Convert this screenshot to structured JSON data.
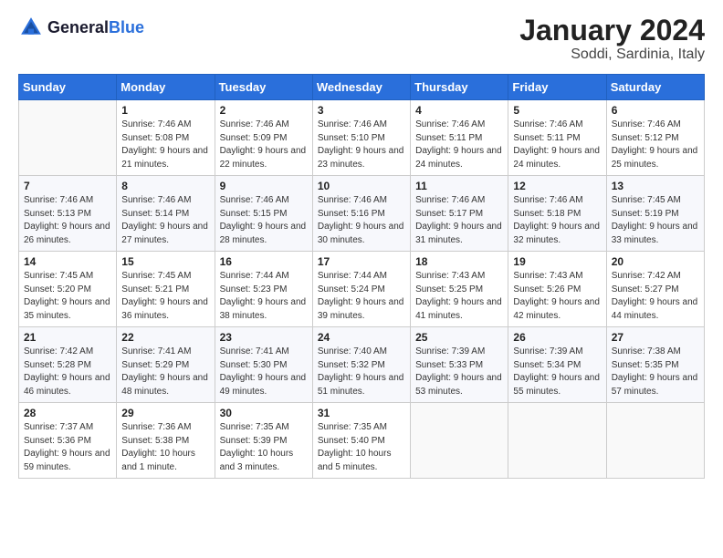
{
  "logo": {
    "general": "General",
    "blue": "Blue"
  },
  "title": "January 2024",
  "subtitle": "Soddi, Sardinia, Italy",
  "weekdays": [
    "Sunday",
    "Monday",
    "Tuesday",
    "Wednesday",
    "Thursday",
    "Friday",
    "Saturday"
  ],
  "weeks": [
    [
      {
        "day": "",
        "sunrise": "",
        "sunset": "",
        "daylight": ""
      },
      {
        "day": "1",
        "sunrise": "Sunrise: 7:46 AM",
        "sunset": "Sunset: 5:08 PM",
        "daylight": "Daylight: 9 hours and 21 minutes."
      },
      {
        "day": "2",
        "sunrise": "Sunrise: 7:46 AM",
        "sunset": "Sunset: 5:09 PM",
        "daylight": "Daylight: 9 hours and 22 minutes."
      },
      {
        "day": "3",
        "sunrise": "Sunrise: 7:46 AM",
        "sunset": "Sunset: 5:10 PM",
        "daylight": "Daylight: 9 hours and 23 minutes."
      },
      {
        "day": "4",
        "sunrise": "Sunrise: 7:46 AM",
        "sunset": "Sunset: 5:11 PM",
        "daylight": "Daylight: 9 hours and 24 minutes."
      },
      {
        "day": "5",
        "sunrise": "Sunrise: 7:46 AM",
        "sunset": "Sunset: 5:11 PM",
        "daylight": "Daylight: 9 hours and 24 minutes."
      },
      {
        "day": "6",
        "sunrise": "Sunrise: 7:46 AM",
        "sunset": "Sunset: 5:12 PM",
        "daylight": "Daylight: 9 hours and 25 minutes."
      }
    ],
    [
      {
        "day": "7",
        "sunrise": "Sunrise: 7:46 AM",
        "sunset": "Sunset: 5:13 PM",
        "daylight": "Daylight: 9 hours and 26 minutes."
      },
      {
        "day": "8",
        "sunrise": "Sunrise: 7:46 AM",
        "sunset": "Sunset: 5:14 PM",
        "daylight": "Daylight: 9 hours and 27 minutes."
      },
      {
        "day": "9",
        "sunrise": "Sunrise: 7:46 AM",
        "sunset": "Sunset: 5:15 PM",
        "daylight": "Daylight: 9 hours and 28 minutes."
      },
      {
        "day": "10",
        "sunrise": "Sunrise: 7:46 AM",
        "sunset": "Sunset: 5:16 PM",
        "daylight": "Daylight: 9 hours and 30 minutes."
      },
      {
        "day": "11",
        "sunrise": "Sunrise: 7:46 AM",
        "sunset": "Sunset: 5:17 PM",
        "daylight": "Daylight: 9 hours and 31 minutes."
      },
      {
        "day": "12",
        "sunrise": "Sunrise: 7:46 AM",
        "sunset": "Sunset: 5:18 PM",
        "daylight": "Daylight: 9 hours and 32 minutes."
      },
      {
        "day": "13",
        "sunrise": "Sunrise: 7:45 AM",
        "sunset": "Sunset: 5:19 PM",
        "daylight": "Daylight: 9 hours and 33 minutes."
      }
    ],
    [
      {
        "day": "14",
        "sunrise": "Sunrise: 7:45 AM",
        "sunset": "Sunset: 5:20 PM",
        "daylight": "Daylight: 9 hours and 35 minutes."
      },
      {
        "day": "15",
        "sunrise": "Sunrise: 7:45 AM",
        "sunset": "Sunset: 5:21 PM",
        "daylight": "Daylight: 9 hours and 36 minutes."
      },
      {
        "day": "16",
        "sunrise": "Sunrise: 7:44 AM",
        "sunset": "Sunset: 5:23 PM",
        "daylight": "Daylight: 9 hours and 38 minutes."
      },
      {
        "day": "17",
        "sunrise": "Sunrise: 7:44 AM",
        "sunset": "Sunset: 5:24 PM",
        "daylight": "Daylight: 9 hours and 39 minutes."
      },
      {
        "day": "18",
        "sunrise": "Sunrise: 7:43 AM",
        "sunset": "Sunset: 5:25 PM",
        "daylight": "Daylight: 9 hours and 41 minutes."
      },
      {
        "day": "19",
        "sunrise": "Sunrise: 7:43 AM",
        "sunset": "Sunset: 5:26 PM",
        "daylight": "Daylight: 9 hours and 42 minutes."
      },
      {
        "day": "20",
        "sunrise": "Sunrise: 7:42 AM",
        "sunset": "Sunset: 5:27 PM",
        "daylight": "Daylight: 9 hours and 44 minutes."
      }
    ],
    [
      {
        "day": "21",
        "sunrise": "Sunrise: 7:42 AM",
        "sunset": "Sunset: 5:28 PM",
        "daylight": "Daylight: 9 hours and 46 minutes."
      },
      {
        "day": "22",
        "sunrise": "Sunrise: 7:41 AM",
        "sunset": "Sunset: 5:29 PM",
        "daylight": "Daylight: 9 hours and 48 minutes."
      },
      {
        "day": "23",
        "sunrise": "Sunrise: 7:41 AM",
        "sunset": "Sunset: 5:30 PM",
        "daylight": "Daylight: 9 hours and 49 minutes."
      },
      {
        "day": "24",
        "sunrise": "Sunrise: 7:40 AM",
        "sunset": "Sunset: 5:32 PM",
        "daylight": "Daylight: 9 hours and 51 minutes."
      },
      {
        "day": "25",
        "sunrise": "Sunrise: 7:39 AM",
        "sunset": "Sunset: 5:33 PM",
        "daylight": "Daylight: 9 hours and 53 minutes."
      },
      {
        "day": "26",
        "sunrise": "Sunrise: 7:39 AM",
        "sunset": "Sunset: 5:34 PM",
        "daylight": "Daylight: 9 hours and 55 minutes."
      },
      {
        "day": "27",
        "sunrise": "Sunrise: 7:38 AM",
        "sunset": "Sunset: 5:35 PM",
        "daylight": "Daylight: 9 hours and 57 minutes."
      }
    ],
    [
      {
        "day": "28",
        "sunrise": "Sunrise: 7:37 AM",
        "sunset": "Sunset: 5:36 PM",
        "daylight": "Daylight: 9 hours and 59 minutes."
      },
      {
        "day": "29",
        "sunrise": "Sunrise: 7:36 AM",
        "sunset": "Sunset: 5:38 PM",
        "daylight": "Daylight: 10 hours and 1 minute."
      },
      {
        "day": "30",
        "sunrise": "Sunrise: 7:35 AM",
        "sunset": "Sunset: 5:39 PM",
        "daylight": "Daylight: 10 hours and 3 minutes."
      },
      {
        "day": "31",
        "sunrise": "Sunrise: 7:35 AM",
        "sunset": "Sunset: 5:40 PM",
        "daylight": "Daylight: 10 hours and 5 minutes."
      },
      {
        "day": "",
        "sunrise": "",
        "sunset": "",
        "daylight": ""
      },
      {
        "day": "",
        "sunrise": "",
        "sunset": "",
        "daylight": ""
      },
      {
        "day": "",
        "sunrise": "",
        "sunset": "",
        "daylight": ""
      }
    ]
  ]
}
